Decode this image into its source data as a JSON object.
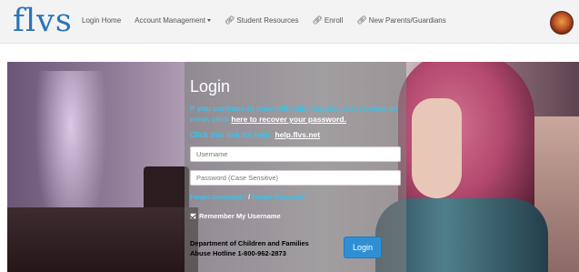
{
  "header": {
    "logo": "flvs",
    "nav": [
      {
        "label": "Login Home",
        "icon": "",
        "dropdown": false
      },
      {
        "label": "Account Management",
        "icon": "",
        "dropdown": true
      },
      {
        "label": "Student Resources",
        "icon": "link-icon",
        "dropdown": false
      },
      {
        "label": "Enroll",
        "icon": "link-icon",
        "dropdown": false
      },
      {
        "label": "New Parents/Guardians",
        "icon": "link-icon",
        "dropdown": false
      }
    ],
    "seal_icon": "state-seal-icon"
  },
  "login": {
    "title": "Login",
    "info_prefix": "If you continue to have difficulty logging in or receive an error, click ",
    "info_link": "here to recover your password.",
    "help_prefix": "Click this link for help: ",
    "help_link": "help.flvs.net",
    "username_placeholder": "Username",
    "password_placeholder": "Password (Case Sensitive)",
    "forgot_username": "Forgot Username?",
    "forgot_separator": " / ",
    "forgot_password": "Forgot Password?",
    "remember_label": "Remember My Username",
    "remember_checked": true,
    "hotline_line1": "Department of Children and Families",
    "hotline_line2": "Abuse Hotline 1-800-962-2873",
    "login_button": "Login"
  },
  "colors": {
    "logo": "#2a73b8",
    "accent_text": "#39c3ea",
    "button": "#2f8fd6"
  }
}
